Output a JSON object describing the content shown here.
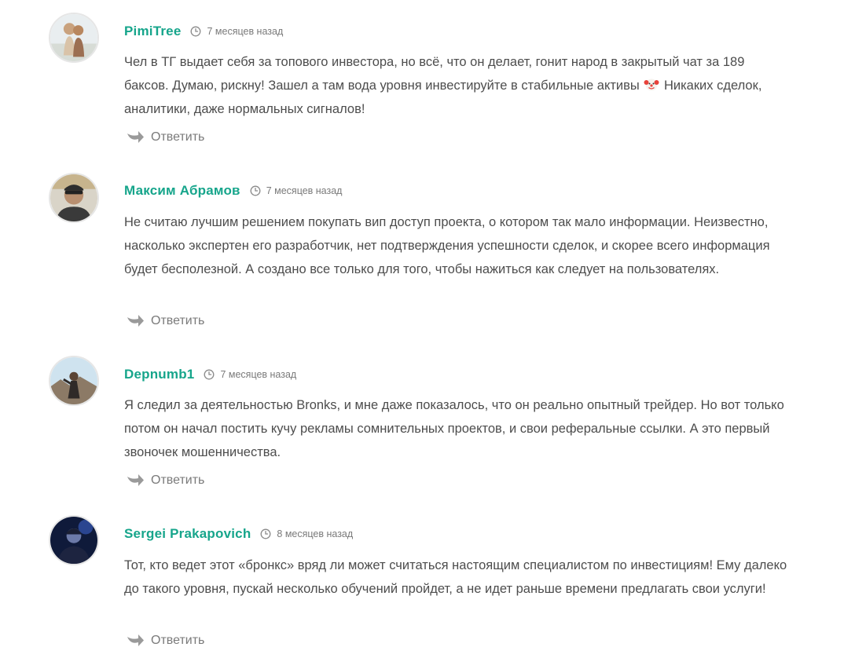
{
  "comments": [
    {
      "author": "PimiTree",
      "time": "7 месяцев назад",
      "text_before_emoji": "Чел в ТГ выдает себя за топового инвестора, но всё, что он делает, гонит народ в закрытый чат за 189 баксов. Думаю, рискну! Зашел а там вода уровня инвестируйте в стабильные активы ",
      "emoji": "clown-face-emoji",
      "text_after_emoji": " Никаких сделок, аналитики, даже нормальных сигналов!",
      "reply_label": "Ответить"
    },
    {
      "author": "Максим Абрамов",
      "time": "7 месяцев назад",
      "text": "Не считаю лучшим решением покупать вип доступ проекта, о котором так мало информации. Неизвестно, насколько экспертен его разработчик, нет подтверждения успешности сделок, и скорее всего информация будет бесполезной. А создано все только для того, чтобы нажиться как следует на пользователях.",
      "reply_label": "Ответить"
    },
    {
      "author": "Depnumb1",
      "time": "7 месяцев назад",
      "text": "Я следил за деятельностью Bronks, и мне даже показалось, что он реально опытный трейдер. Но вот только потом он начал постить кучу рекламы сомнительных проектов, и свои реферальные ссылки. А это первый звоночек мошенничества.",
      "reply_label": "Ответить"
    },
    {
      "author": "Sergei Prakapovich",
      "time": "8 месяцев назад",
      "text": "Тот, кто ведет этот «бронкс» вряд ли может считаться настоящим специалистом по инвестициям! Ему далеко до такого уровня, пускай несколько обучений пройдет, а не идет раньше времени предлагать свои услуги!",
      "reply_label": "Ответить"
    }
  ],
  "colors": {
    "author": "#16a58b",
    "meta": "#7a7a7a",
    "text": "#4d4d4d"
  },
  "icons": {
    "time": "clock-icon",
    "reply": "reply-arrow-icon"
  }
}
